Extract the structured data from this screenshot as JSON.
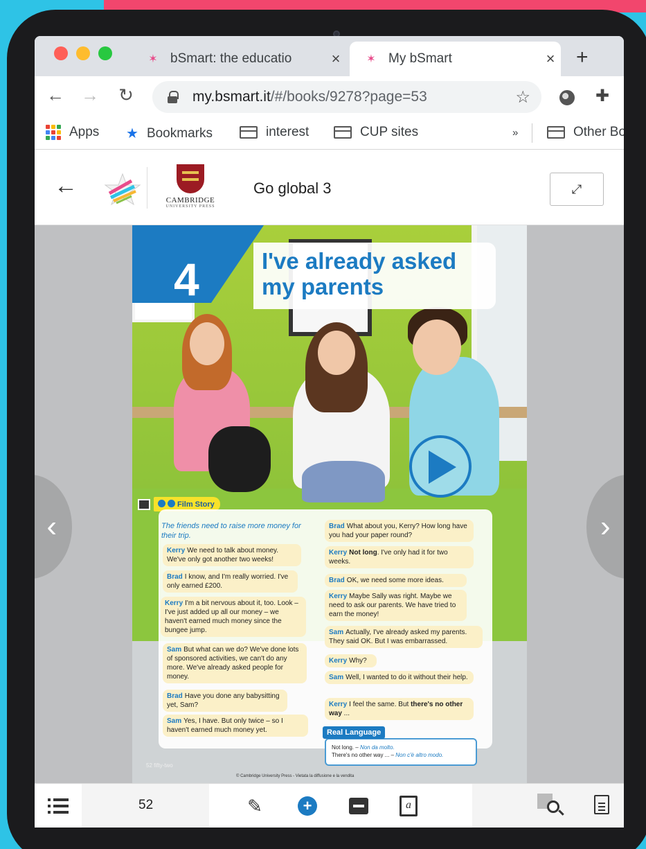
{
  "browser": {
    "tabs": [
      {
        "title": "bSmart: the educatio",
        "active": false
      },
      {
        "title": "My bSmart",
        "active": true
      }
    ],
    "tab_close": "×",
    "new_tab": "+",
    "url_host": "my.bsmart.it",
    "url_path": "/#/books/9278?page=53",
    "bookmarks": [
      {
        "label": "Apps",
        "icon": "apps-grid-icon"
      },
      {
        "label": "Bookmarks",
        "icon": "star-icon"
      },
      {
        "label": "interest",
        "icon": "folder-icon"
      },
      {
        "label": "CUP sites",
        "icon": "folder-icon"
      }
    ],
    "overflow": "»",
    "other_bookmarks": "Other Bo"
  },
  "app": {
    "publisher_line1": "CAMBRIDGE",
    "publisher_line2": "UNIVERSITY PRESS",
    "book_title": "Go global 3"
  },
  "page": {
    "unit_number": "4",
    "unit_title": "I've already asked my parents",
    "section_label": "Film Story",
    "intro": "The friends need to raise more money for their trip.",
    "left_bubbles": [
      {
        "speaker": "Kerry",
        "text": "We need to talk about money. We've only got another two weeks!"
      },
      {
        "speaker": "Brad",
        "text": "I know, and I'm really worried. I've only earned £200."
      },
      {
        "speaker": "Kerry",
        "text": "I'm a bit nervous about it, too. Look – I've just added up all our money – we haven't earned much money since the bungee jump."
      },
      {
        "speaker": "Sam",
        "text": "But what can we do? We've done lots of sponsored activities, we can't do any more. We've already asked people for money."
      },
      {
        "speaker": "Brad",
        "text": "Have you done any babysitting yet, Sam?"
      },
      {
        "speaker": "Sam",
        "text": "Yes, I have. But only twice – so I haven't earned much money yet."
      }
    ],
    "right_bubbles": [
      {
        "speaker": "Brad",
        "text": "What about you, Kerry? How long have you had your paper round?"
      },
      {
        "speaker": "Kerry",
        "bold": "Not long",
        "text": ". I've only had it for two weeks."
      },
      {
        "speaker": "Brad",
        "text": "OK, we need some more ideas."
      },
      {
        "speaker": "Kerry",
        "text": "Maybe Sally was right. Maybe we need to ask our parents. We have tried to earn the money!"
      },
      {
        "speaker": "Sam",
        "text": "Actually, I've already asked my parents. They said OK. But I was embarrassed."
      },
      {
        "speaker": "Kerry",
        "text": "Why?"
      },
      {
        "speaker": "Sam",
        "text": "Well, I wanted to do it without their help."
      },
      {
        "speaker": "Kerry",
        "text": "I feel the same. But",
        "bold_tail": "there's no other way",
        "tail": " ..."
      }
    ],
    "real_language_label": "Real Language",
    "real_language_line1_en": "Not long. –",
    "real_language_line1_it": "Non da molto.",
    "real_language_line2_en": "There's no other way ... –",
    "real_language_line2_it": "Non c'è altro modo.",
    "page_footer": "52  fifty-two",
    "copyright": "© Cambridge University Press - Vietata la diffusione e la vendita"
  },
  "nav": {
    "prev": "‹",
    "next": "›"
  },
  "bottom": {
    "page_number": "52"
  },
  "colors": {
    "accent_blue": "#1c7bc2",
    "highlight_yellow": "#f7e22a",
    "background_cyan": "#2ec3e6",
    "background_pink": "#f2466d"
  }
}
